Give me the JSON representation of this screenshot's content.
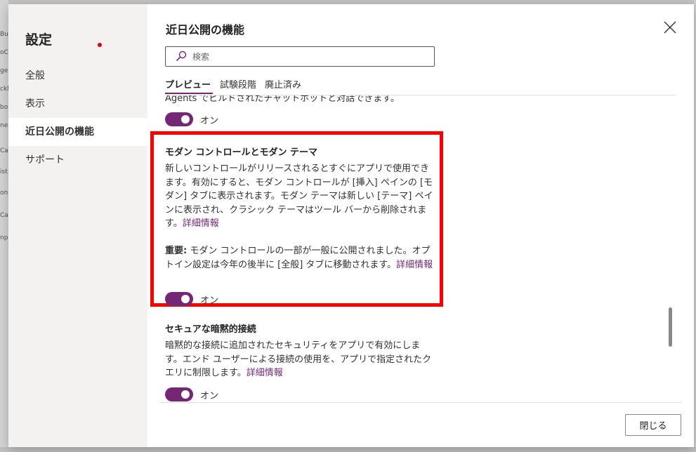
{
  "background": {
    "left_fragments": [
      "Bu",
      "oC",
      "ge",
      "ckl",
      "bo",
      "ne",
      "Ca",
      "ist",
      "on",
      "Ca",
      "np"
    ]
  },
  "nav": {
    "title": "設定",
    "items": [
      {
        "label": "全般",
        "active": false
      },
      {
        "label": "表示",
        "active": false
      },
      {
        "label": "近日公開の機能",
        "active": true
      },
      {
        "label": "サポート",
        "active": false
      }
    ]
  },
  "dialog": {
    "title": "近日公開の機能",
    "close_icon": "close-icon"
  },
  "search": {
    "placeholder": "検索",
    "icon": "search-icon"
  },
  "tabs": [
    {
      "label": "プレビュー",
      "active": true
    },
    {
      "label": "試験段階",
      "active": false
    },
    {
      "label": "廃止済み",
      "active": false
    }
  ],
  "features": {
    "prev": {
      "desc_tail": "Agents でビルドされたチャットボットと対話できます。",
      "toggle_label": "オン",
      "toggle_on": true
    },
    "modern": {
      "title": "モダン コントロールとモダン テーマ",
      "desc": "新しいコントロールがリリースされるとすぐにアプリで使用できます。有効にすると、モダン コントロールが [挿入] ペインの [モダン] タブに表示されます。モダン テーマは新しい [テーマ] ペインに表示され、クラシック テーマはツール バーから削除されます。",
      "link": "詳細情報",
      "important_label": "重要:",
      "important_text": " モダン コントロールの一部が一般に公開されました。オプトイン設定は今年の後半に [全般] タブに移動されます。",
      "important_link": "詳細情報",
      "toggle_label": "オン",
      "toggle_on": true
    },
    "secure": {
      "title": "セキュアな暗黙的接続",
      "desc": "暗黙的な接続に追加されたセキュリティをアプリで有効にします。エンド ユーザーによる接続の使用を、アプリで指定されたクエリに制限します。",
      "link": "詳細情報",
      "toggle_label": "オン",
      "toggle_on": true
    }
  },
  "footer": {
    "close_label": "閉じる"
  },
  "colors": {
    "accent": "#742774",
    "highlight": "#ff0000",
    "nav_bg": "#f3f2f1"
  }
}
